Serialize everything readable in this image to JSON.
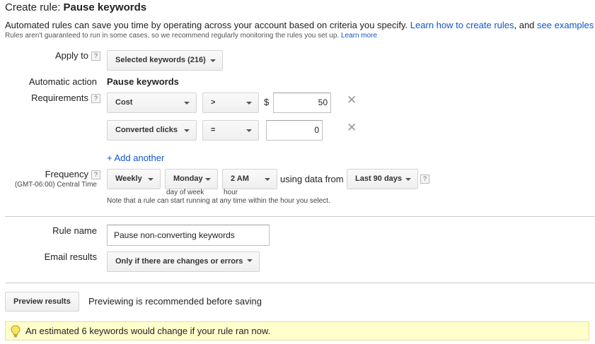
{
  "header": {
    "title_prefix": "Create rule:",
    "title_name": "Pause keywords",
    "description": "Automated rules can save you time by operating across your account based on criteria you specify.",
    "learn_how_link": "Learn how to create rules",
    "and_text": ", and",
    "see_examples_link": "see examples",
    "disclaimer": "Rules aren't guaranteed to run in some cases, so we recommend regularly monitoring the rules you set up.",
    "learn_more_link": "Learn more"
  },
  "apply_to": {
    "label": "Apply to",
    "help": "?",
    "value": "Selected keywords (216)"
  },
  "automatic_action": {
    "label": "Automatic action",
    "value": "Pause keywords"
  },
  "requirements": {
    "label": "Requirements",
    "help": "?",
    "rows": [
      {
        "metric": "Cost",
        "operator": ">",
        "currency": "$",
        "value": "50",
        "remove": "✕"
      },
      {
        "metric": "Converted clicks",
        "operator": "=",
        "currency": "",
        "value": "0",
        "remove": "✕"
      }
    ],
    "add_another": "+ Add another"
  },
  "frequency": {
    "label": "Frequency",
    "help": "?",
    "timezone": "(GMT-06:00) Central Time",
    "period": "Weekly",
    "day": "Monday",
    "day_label": "day of week",
    "hour": "2 AM",
    "hour_label": "hour",
    "using_data_from": "using data from",
    "range": "Last 90 days",
    "range_help": "?",
    "note": "Note that a rule can start running at any time within the hour you select."
  },
  "rule_name": {
    "label": "Rule name",
    "value": "Pause non-converting keywords"
  },
  "email_results": {
    "label": "Email results",
    "value": "Only if there are changes or errors"
  },
  "preview": {
    "button": "Preview results",
    "hint": "Previewing is recommended before saving"
  },
  "notice": {
    "icon": "lightbulb-icon",
    "text": "An estimated 6 keywords would change if your rule ran now."
  },
  "colors": {
    "link": "#1155cc",
    "notice_bg": "#ffffcc"
  }
}
